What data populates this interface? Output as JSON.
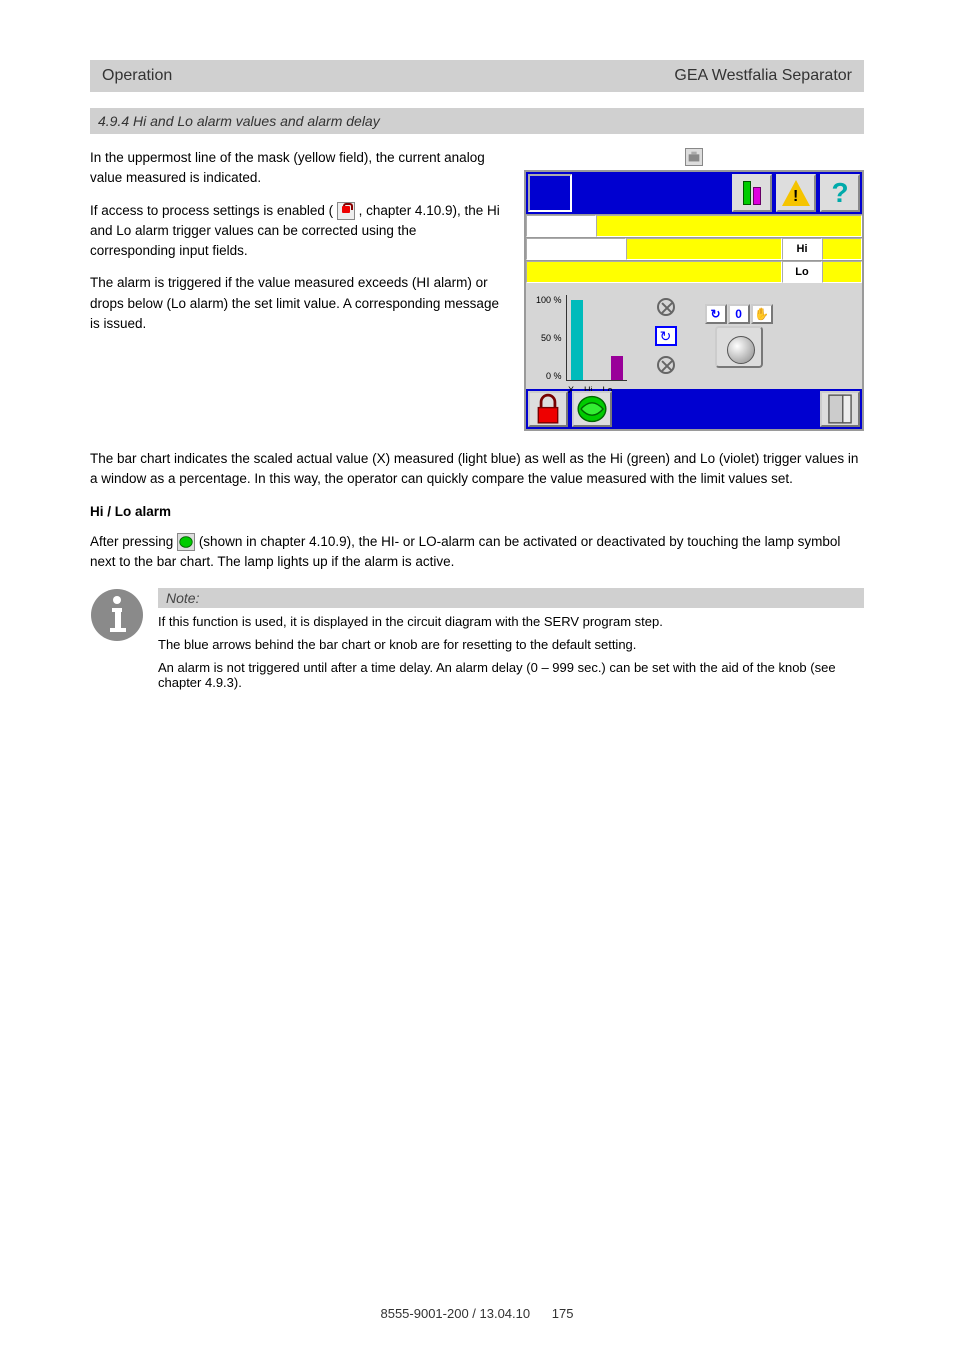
{
  "header": {
    "left": "Operation",
    "right": "GEA Westfalia Separator"
  },
  "subhead": "4.9.4  Hi and Lo alarm values and alarm delay",
  "intro1": "In the uppermost line of the mask (yellow field), the current analog value measured is indicated.",
  "intro2": "If access to process settings is enabled (",
  "intro3": ", chapter 4.10.9), the Hi and Lo alarm trigger values can be corrected using the corresponding input fields.",
  "intro4": "The alarm is triggered if the value measured exceeds (HI alarm) or drops below (Lo alarm) the set limit value. A corresponding message is issued.",
  "intro5": "The bar chart indicates the scaled actual value (X) measured (light blue) as well as the Hi (green) and Lo (violet) trigger values in a window as a percentage. In this way, the operator can quickly compare the value measured with the limit values set.",
  "panel": {
    "hi_label": "Hi",
    "lo_label": "Lo",
    "ticks": [
      "100 %",
      "50 %",
      "0 %"
    ],
    "xlabels": [
      "X",
      "Hi",
      "Lo"
    ],
    "knob_zero": "0"
  },
  "chart_data": {
    "type": "bar",
    "categories": [
      "X",
      "Hi",
      "Lo"
    ],
    "values": [
      93,
      0,
      28
    ],
    "ylabel": "%",
    "ylim": [
      0,
      100
    ],
    "colors": [
      "#00bbbb",
      "#009900",
      "#990099"
    ]
  },
  "cameo": {
    "heading": "Hi / Lo alarm",
    "p1": "After pressing       (shown in chapter 4.10.9), the HI- or LO-alarm can be activated or deactivated by touching the lamp symbol next to the bar chart. The lamp lights up if the alarm is active.",
    "p2": "The blue arrows behind the bar chart or knob are for resetting to the default setting."
  },
  "note": {
    "heading": "Note:",
    "p1": "If this function is used, it is displayed in the circuit diagram with the SERV program step.",
    "p2": "An alarm is not triggered until after a time delay. An alarm delay (0 – 999 sec.) can be set with the aid of the knob (see chapter 4.9.3)."
  },
  "footer": {
    "doc": "8555-9001-200 / 13.04.10",
    "page": "175"
  }
}
